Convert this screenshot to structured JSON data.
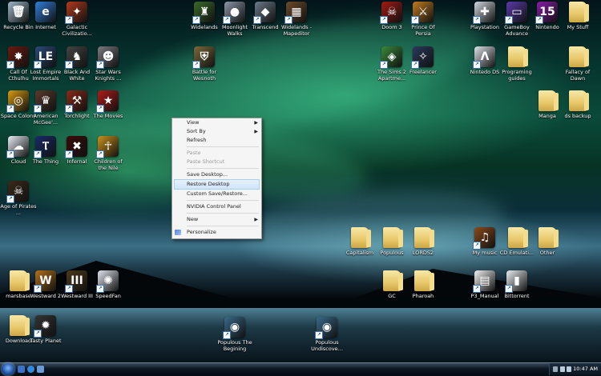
{
  "desktop_icons": [
    {
      "label": "Recycle Bin",
      "icon": "recycle-bin-icon",
      "color": "#9fb8c8",
      "glyph": "🗑"
    },
    {
      "label": "Internet",
      "icon": "internet-explorer-icon",
      "color": "#2f7fd8",
      "glyph": "e"
    },
    {
      "label": "Galactic Civilizatio...",
      "icon": "galactic-civilizations-icon",
      "color": "#b33a1c",
      "glyph": "✦"
    },
    {
      "label": "Widelands",
      "icon": "widelands-icon",
      "color": "#3a6a2a",
      "glyph": "♜"
    },
    {
      "label": "Moonlight Walks",
      "icon": "moonlight-walks-icon",
      "color": "#8c96a8",
      "glyph": "●"
    },
    {
      "label": "Transcend",
      "icon": "transcend-icon",
      "color": "#6a7a8a",
      "glyph": "◆"
    },
    {
      "label": "Widelands - Mapeditor",
      "icon": "widelands-mapeditor-icon",
      "color": "#6c4a2a",
      "glyph": "▦"
    },
    {
      "label": "Doom 3",
      "icon": "doom3-icon",
      "color": "#a31a12",
      "glyph": "☠"
    },
    {
      "label": "Prince Of Persia",
      "icon": "prince-of-persia-icon",
      "color": "#c07a20",
      "glyph": "⚔"
    },
    {
      "label": "Playstation",
      "icon": "playstation-icon",
      "color": "#cfd6e0",
      "glyph": "✚"
    },
    {
      "label": "GameBoy Advance",
      "icon": "gameboy-advance-icon",
      "color": "#5a3aa8",
      "glyph": "▭"
    },
    {
      "label": "Nintendo",
      "icon": "nintendo-icon",
      "color": "#8a1ca8",
      "glyph": "15"
    },
    {
      "label": "My Stuff",
      "icon": "folder-icon",
      "color": "folder",
      "glyph": ""
    },
    {
      "label": "Call Of Cthulhu",
      "icon": "call-of-cthulhu-icon",
      "color": "#6a1a10",
      "glyph": "✸"
    },
    {
      "label": "Lost Empire Immortals",
      "icon": "lost-empire-immortals-icon",
      "color": "#2a4a7a",
      "glyph": "LE"
    },
    {
      "label": "Black And White",
      "icon": "black-and-white-icon",
      "color": "#444",
      "glyph": "♞"
    },
    {
      "label": "Star Wars Knights ...",
      "icon": "star-wars-knights-icon",
      "color": "#7a7a80",
      "glyph": "☻"
    },
    {
      "label": "Battle for Wesnoth",
      "icon": "battle-for-wesnoth-icon",
      "color": "#7a6a3a",
      "glyph": "⛨"
    },
    {
      "label": "The Sims 2 Apartme...",
      "icon": "the-sims-2-icon",
      "color": "#3a8a3a",
      "glyph": "◈"
    },
    {
      "label": "Freelancer",
      "icon": "freelancer-icon",
      "color": "#2a3a5a",
      "glyph": "✧"
    },
    {
      "label": "Nintedo DS",
      "icon": "nintendo-ds-icon",
      "color": "#dde3ea",
      "glyph": "Λ"
    },
    {
      "label": "Programing guides",
      "icon": "folder-icon",
      "color": "folder",
      "glyph": ""
    },
    {
      "label": "Fallacy of Dawn",
      "icon": "folder-icon",
      "color": "folder",
      "glyph": ""
    },
    {
      "label": "Space Colony",
      "icon": "space-colony-icon",
      "color": "#d89a10",
      "glyph": "◎"
    },
    {
      "label": "American McGee'...",
      "icon": "american-mcgee-icon",
      "color": "#5a3a2a",
      "glyph": "♛"
    },
    {
      "label": "Torchlight",
      "icon": "torchlight-icon",
      "color": "#8a2a1a",
      "glyph": "⚒"
    },
    {
      "label": "The Movies",
      "icon": "the-movies-icon",
      "color": "#b21a1a",
      "glyph": "★"
    },
    {
      "label": "Manga",
      "icon": "folder-icon",
      "color": "folder",
      "glyph": ""
    },
    {
      "label": "ds backup",
      "icon": "folder-icon",
      "color": "folder",
      "glyph": ""
    },
    {
      "label": "Cloud",
      "icon": "cloud-icon",
      "color": "#e8eef5",
      "glyph": "☁"
    },
    {
      "label": "The Thing",
      "icon": "the-thing-icon",
      "color": "#1a2a6a",
      "glyph": "Ⲧ"
    },
    {
      "label": "Infernal",
      "icon": "infernal-icon",
      "color": "#3a0a0a",
      "glyph": "✖"
    },
    {
      "label": "Children of the Nile",
      "icon": "children-of-the-nile-icon",
      "color": "#c8901a",
      "glyph": "☥"
    },
    {
      "label": "Age of Pirates ...",
      "icon": "age-of-pirates-icon",
      "color": "#3a2a1a",
      "glyph": "☠"
    },
    {
      "label": "Capitalism",
      "icon": "folder-icon",
      "color": "folder",
      "glyph": ""
    },
    {
      "label": "Populous",
      "icon": "folder-icon",
      "color": "folder",
      "glyph": ""
    },
    {
      "label": "LORDS2",
      "icon": "folder-icon",
      "color": "folder",
      "glyph": ""
    },
    {
      "label": "My music",
      "icon": "my-music-icon",
      "color": "#8a4a1a",
      "glyph": "♫"
    },
    {
      "label": "CD Emulati...",
      "icon": "folder-icon",
      "color": "folder",
      "glyph": ""
    },
    {
      "label": "Other",
      "icon": "folder-icon",
      "color": "folder",
      "glyph": ""
    },
    {
      "label": "marsbase",
      "icon": "folder-icon",
      "color": "folder",
      "glyph": ""
    },
    {
      "label": "Westward 2",
      "icon": "westward-2-icon",
      "color": "#b2701a",
      "glyph": "W"
    },
    {
      "label": "Westward III",
      "icon": "westward-3-icon",
      "color": "#4a3a1a",
      "glyph": "III"
    },
    {
      "label": "SpeedFan",
      "icon": "speedfan-icon",
      "color": "#dfe5ee",
      "glyph": "✺"
    },
    {
      "label": "GC",
      "icon": "folder-icon",
      "color": "folder",
      "glyph": ""
    },
    {
      "label": "Pharoah",
      "icon": "folder-icon",
      "color": "folder",
      "glyph": ""
    },
    {
      "label": "P3_Manual",
      "icon": "pdf-icon",
      "color": "#f2f2f2",
      "glyph": "▤"
    },
    {
      "label": "Bittorrent",
      "icon": "bittorrent-icon",
      "color": "#e8eef2",
      "glyph": "▮"
    },
    {
      "label": "Download",
      "icon": "folder-icon",
      "color": "folder",
      "glyph": ""
    },
    {
      "label": "Tasty Planet",
      "icon": "tasty-planet-icon",
      "color": "#333",
      "glyph": "✹"
    },
    {
      "label": "Populous The Begining",
      "icon": "populous-the-begining-icon",
      "color": "#3a6a8a",
      "glyph": "◉"
    },
    {
      "label": "Populous Undiscove...",
      "icon": "populous-undiscovered-icon",
      "color": "#3a6a8a",
      "glyph": "◉"
    }
  ],
  "context_menu": {
    "items": [
      {
        "label": "View",
        "submenu": true,
        "disabled": false
      },
      {
        "label": "Sort By",
        "submenu": true,
        "disabled": false
      },
      {
        "label": "Refresh",
        "submenu": false,
        "disabled": false
      },
      {
        "label": "Paste",
        "submenu": false,
        "disabled": true
      },
      {
        "label": "Paste Shortcut",
        "submenu": false,
        "disabled": true
      },
      {
        "label": "Save Desktop...",
        "submenu": false,
        "disabled": false
      },
      {
        "label": "Restore Desktop",
        "submenu": false,
        "disabled": false,
        "highlighted": true
      },
      {
        "label": "Custom Save/Restore...",
        "submenu": false,
        "disabled": false
      },
      {
        "label": "NVIDIA Control Panel",
        "submenu": false,
        "disabled": false
      },
      {
        "label": "New",
        "submenu": true,
        "disabled": false
      },
      {
        "label": "Personalize",
        "submenu": false,
        "disabled": false
      }
    ]
  },
  "taskbar": {
    "clock": "10:47 AM"
  },
  "colors": {
    "menu_highlight": "#cfe5fb",
    "taskbar": "#0c1622"
  }
}
